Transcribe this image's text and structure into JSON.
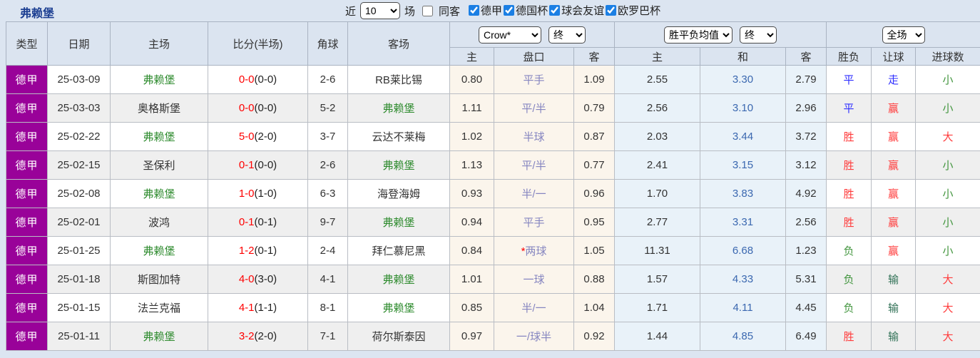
{
  "page": {
    "title": "弗赖堡"
  },
  "topbar": {
    "recent_prefix": "近",
    "recent_select": "10",
    "recent_suffix": "场",
    "same_venue": {
      "label": "同客",
      "checked": false
    },
    "league_filters": [
      {
        "label": "德甲",
        "checked": true
      },
      {
        "label": "德国杯",
        "checked": true
      },
      {
        "label": "球会友谊",
        "checked": true
      },
      {
        "label": "欧罗巴杯",
        "checked": true
      }
    ]
  },
  "table": {
    "columns": {
      "type": "类型",
      "date": "日期",
      "home": "主场",
      "score": "比分(半场)",
      "corner": "角球",
      "away": "客场",
      "odds_home": "主",
      "odds_handicap": "盘口",
      "odds_away": "客",
      "avg_home": "主",
      "avg_draw": "和",
      "avg_away": "客",
      "result": "胜负",
      "handicap_result": "让球",
      "goals": "进球数"
    },
    "selects": {
      "odds_company": "Crow*",
      "odds_time": "终",
      "avg_source": "胜平负均值",
      "avg_time": "终",
      "scope": "全场"
    },
    "rows": [
      {
        "type": "德甲",
        "date": "25-03-09",
        "home": {
          "text": "弗赖堡",
          "highlight": true
        },
        "score": "0-0",
        "half": "(0-0)",
        "corner": "2-6",
        "away": {
          "text": "RB莱比锡",
          "highlight": false
        },
        "odds_home": "0.80",
        "handicap": {
          "text": "平手",
          "star": false
        },
        "odds_away": "1.09",
        "avg_home": "2.55",
        "avg_draw": "3.30",
        "avg_away": "2.79",
        "result": {
          "text": "平",
          "color": "blue"
        },
        "handicap_result": {
          "text": "走",
          "color": "blue"
        },
        "goals": {
          "text": "小",
          "color": "green"
        }
      },
      {
        "type": "德甲",
        "date": "25-03-03",
        "home": {
          "text": "奥格斯堡",
          "highlight": false
        },
        "score": "0-0",
        "half": "(0-0)",
        "corner": "5-2",
        "away": {
          "text": "弗赖堡",
          "highlight": true
        },
        "odds_home": "1.11",
        "handicap": {
          "text": "平/半",
          "star": false
        },
        "odds_away": "0.79",
        "avg_home": "2.56",
        "avg_draw": "3.10",
        "avg_away": "2.96",
        "result": {
          "text": "平",
          "color": "blue"
        },
        "handicap_result": {
          "text": "赢",
          "color": "red"
        },
        "goals": {
          "text": "小",
          "color": "green"
        }
      },
      {
        "type": "德甲",
        "date": "25-02-22",
        "home": {
          "text": "弗赖堡",
          "highlight": true
        },
        "score": "5-0",
        "half": "(2-0)",
        "corner": "3-7",
        "away": {
          "text": "云达不莱梅",
          "highlight": false
        },
        "odds_home": "1.02",
        "handicap": {
          "text": "半球",
          "star": false
        },
        "odds_away": "0.87",
        "avg_home": "2.03",
        "avg_draw": "3.44",
        "avg_away": "3.72",
        "result": {
          "text": "胜",
          "color": "red"
        },
        "handicap_result": {
          "text": "赢",
          "color": "red"
        },
        "goals": {
          "text": "大",
          "color": "red"
        }
      },
      {
        "type": "德甲",
        "date": "25-02-15",
        "home": {
          "text": "圣保利",
          "highlight": false
        },
        "score": "0-1",
        "half": "(0-0)",
        "corner": "2-6",
        "away": {
          "text": "弗赖堡",
          "highlight": true
        },
        "odds_home": "1.13",
        "handicap": {
          "text": "平/半",
          "star": false
        },
        "odds_away": "0.77",
        "avg_home": "2.41",
        "avg_draw": "3.15",
        "avg_away": "3.12",
        "result": {
          "text": "胜",
          "color": "red"
        },
        "handicap_result": {
          "text": "赢",
          "color": "red"
        },
        "goals": {
          "text": "小",
          "color": "green"
        }
      },
      {
        "type": "德甲",
        "date": "25-02-08",
        "home": {
          "text": "弗赖堡",
          "highlight": true
        },
        "score": "1-0",
        "half": "(1-0)",
        "corner": "6-3",
        "away": {
          "text": "海登海姆",
          "highlight": false
        },
        "odds_home": "0.93",
        "handicap": {
          "text": "半/一",
          "star": false
        },
        "odds_away": "0.96",
        "avg_home": "1.70",
        "avg_draw": "3.83",
        "avg_away": "4.92",
        "result": {
          "text": "胜",
          "color": "red"
        },
        "handicap_result": {
          "text": "赢",
          "color": "red"
        },
        "goals": {
          "text": "小",
          "color": "green"
        }
      },
      {
        "type": "德甲",
        "date": "25-02-01",
        "home": {
          "text": "波鸿",
          "highlight": false
        },
        "score": "0-1",
        "half": "(0-1)",
        "corner": "9-7",
        "away": {
          "text": "弗赖堡",
          "highlight": true
        },
        "odds_home": "0.94",
        "handicap": {
          "text": "平手",
          "star": false
        },
        "odds_away": "0.95",
        "avg_home": "2.77",
        "avg_draw": "3.31",
        "avg_away": "2.56",
        "result": {
          "text": "胜",
          "color": "red"
        },
        "handicap_result": {
          "text": "赢",
          "color": "red"
        },
        "goals": {
          "text": "小",
          "color": "green"
        }
      },
      {
        "type": "德甲",
        "date": "25-01-25",
        "home": {
          "text": "弗赖堡",
          "highlight": true
        },
        "score": "1-2",
        "half": "(0-1)",
        "corner": "2-4",
        "away": {
          "text": "拜仁慕尼黑",
          "highlight": false
        },
        "odds_home": "0.84",
        "handicap": {
          "text": "两球",
          "star": true
        },
        "odds_away": "1.05",
        "avg_home": "11.31",
        "avg_draw": "6.68",
        "avg_away": "1.23",
        "result": {
          "text": "负",
          "color": "green"
        },
        "handicap_result": {
          "text": "赢",
          "color": "red"
        },
        "goals": {
          "text": "小",
          "color": "green"
        }
      },
      {
        "type": "德甲",
        "date": "25-01-18",
        "home": {
          "text": "斯图加特",
          "highlight": false
        },
        "score": "4-0",
        "half": "(3-0)",
        "corner": "4-1",
        "away": {
          "text": "弗赖堡",
          "highlight": true
        },
        "odds_home": "1.01",
        "handicap": {
          "text": "一球",
          "star": false
        },
        "odds_away": "0.88",
        "avg_home": "1.57",
        "avg_draw": "4.33",
        "avg_away": "5.31",
        "result": {
          "text": "负",
          "color": "green"
        },
        "handicap_result": {
          "text": "输",
          "color": "dgreen"
        },
        "goals": {
          "text": "大",
          "color": "red"
        }
      },
      {
        "type": "德甲",
        "date": "25-01-15",
        "home": {
          "text": "法兰克福",
          "highlight": false
        },
        "score": "4-1",
        "half": "(1-1)",
        "corner": "8-1",
        "away": {
          "text": "弗赖堡",
          "highlight": true
        },
        "odds_home": "0.85",
        "handicap": {
          "text": "半/一",
          "star": false
        },
        "odds_away": "1.04",
        "avg_home": "1.71",
        "avg_draw": "4.11",
        "avg_away": "4.45",
        "result": {
          "text": "负",
          "color": "green"
        },
        "handicap_result": {
          "text": "输",
          "color": "dgreen"
        },
        "goals": {
          "text": "大",
          "color": "red"
        }
      },
      {
        "type": "德甲",
        "date": "25-01-11",
        "home": {
          "text": "弗赖堡",
          "highlight": true
        },
        "score": "3-2",
        "half": "(2-0)",
        "corner": "7-1",
        "away": {
          "text": "荷尔斯泰因",
          "highlight": false
        },
        "odds_home": "0.97",
        "handicap": {
          "text": "一/球半",
          "star": false
        },
        "odds_away": "0.92",
        "avg_home": "1.44",
        "avg_draw": "4.85",
        "avg_away": "6.49",
        "result": {
          "text": "胜",
          "color": "red"
        },
        "handicap_result": {
          "text": "输",
          "color": "dgreen"
        },
        "goals": {
          "text": "大",
          "color": "red"
        }
      }
    ]
  },
  "colors": {
    "page_background": "#dce5f1",
    "title_blue": "#1c3f92",
    "league_badge_purple": "#990299",
    "team_green": "#2e8b2e",
    "score_red": "#fe0000",
    "handicap_purple": "#8585c0",
    "avg_draw_blue": "#3b68b0",
    "win_red": "#ff3b3b",
    "draw_blue": "#2f2fff",
    "lose_green": "#43963f",
    "lose_handicap_green": "#2f7055",
    "odds_column_bg": "#fbf5ec",
    "avg_column_bg": "#e9f2f9",
    "checkbox_blue": "#1b7fe4"
  }
}
